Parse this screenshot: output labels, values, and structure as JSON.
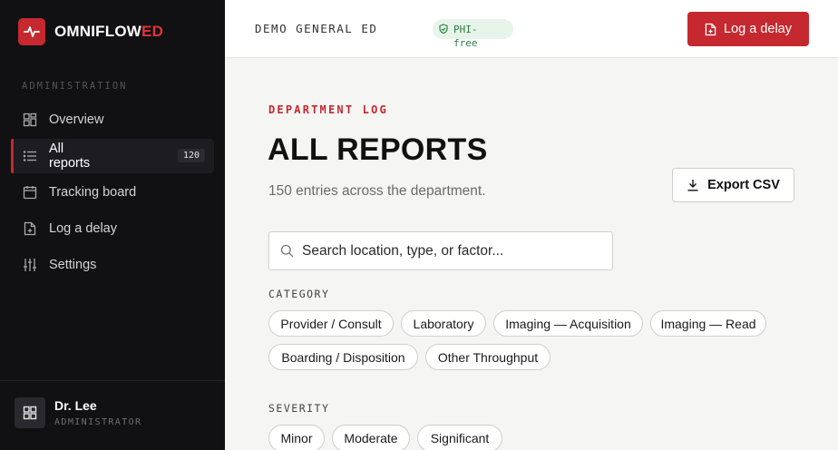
{
  "sidebar": {
    "brand": {
      "name_main": "OMNIFLOW",
      "name_accent": "ED",
      "icon": "pulse-icon"
    },
    "section_label": "ADMINISTRATION",
    "items": [
      {
        "label": "Overview",
        "icon": "dashboard-icon"
      },
      {
        "label": "All reports",
        "icon": "list-icon",
        "badge": "120",
        "active": true
      },
      {
        "label": "Tracking board",
        "icon": "calendar-icon"
      },
      {
        "label": "Log a delay",
        "icon": "file-plus-icon"
      },
      {
        "label": "Settings",
        "icon": "sliders-icon"
      }
    ],
    "user": {
      "name": "Dr. Lee",
      "role": "ADMINISTRATOR",
      "avatar_icon": "grid-avatar-icon"
    }
  },
  "header": {
    "department": "DEMO GENERAL ED",
    "phi_badge": "PHI-free",
    "log_button": "Log a delay"
  },
  "main": {
    "eyebrow": "DEPARTMENT LOG",
    "title": "ALL REPORTS",
    "subtitle": "150 entries across the department.",
    "export_button": "Export CSV",
    "search": {
      "placeholder": "Search location, type, or factor..."
    },
    "category": {
      "label": "CATEGORY",
      "chips": [
        "Provider / Consult",
        "Laboratory",
        "Imaging — Acquisition",
        "Imaging — Read",
        "Boarding / Disposition",
        "Other Throughput"
      ]
    },
    "severity": {
      "label": "SEVERITY",
      "chips": [
        "Minor",
        "Moderate",
        "Significant"
      ]
    }
  },
  "colors": {
    "accent": "#c6282f",
    "sidebar_bg": "#111113",
    "page_bg": "#f5f5f4",
    "phi_bg": "#e6f4ea",
    "phi_fg": "#2e7d44"
  }
}
